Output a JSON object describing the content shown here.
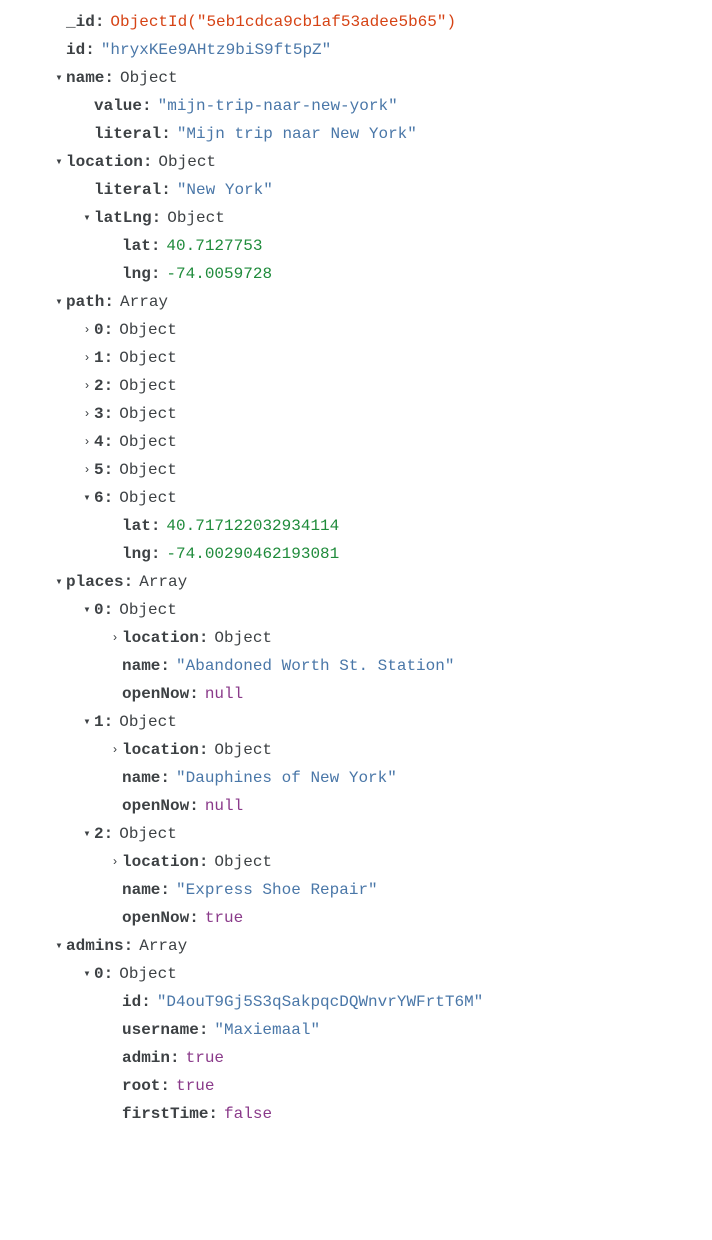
{
  "indentUnit": 28,
  "baseIndent": 52,
  "chevrons": {
    "down": "▾",
    "right": "›"
  },
  "rows": [
    {
      "level": 0,
      "chevron": "none",
      "key": "_id",
      "valueType": "objectid",
      "value": "ObjectId(\"5eb1cdca9cb1af53adee5b65\")"
    },
    {
      "level": 0,
      "chevron": "none",
      "key": "id",
      "valueType": "string",
      "value": "\"hryxKEe9AHtz9biS9ft5pZ\""
    },
    {
      "level": 0,
      "chevron": "down",
      "key": "name",
      "valueType": "type",
      "value": "Object"
    },
    {
      "level": 1,
      "chevron": "none",
      "key": "value",
      "valueType": "string",
      "value": "\"mijn-trip-naar-new-york\""
    },
    {
      "level": 1,
      "chevron": "none",
      "key": "literal",
      "valueType": "string",
      "value": "\"Mijn trip naar New York\""
    },
    {
      "level": 0,
      "chevron": "down",
      "key": "location",
      "valueType": "type",
      "value": "Object"
    },
    {
      "level": 1,
      "chevron": "none",
      "key": "literal",
      "valueType": "string",
      "value": "\"New York\""
    },
    {
      "level": 1,
      "chevron": "down",
      "key": "latLng",
      "valueType": "type",
      "value": "Object"
    },
    {
      "level": 2,
      "chevron": "none",
      "key": "lat",
      "valueType": "number",
      "value": "40.7127753"
    },
    {
      "level": 2,
      "chevron": "none",
      "key": "lng",
      "valueType": "number",
      "value": "-74.0059728"
    },
    {
      "level": 0,
      "chevron": "down",
      "key": "path",
      "valueType": "type",
      "value": "Array"
    },
    {
      "level": 1,
      "chevron": "right",
      "key": "0",
      "valueType": "type",
      "value": "Object"
    },
    {
      "level": 1,
      "chevron": "right",
      "key": "1",
      "valueType": "type",
      "value": "Object"
    },
    {
      "level": 1,
      "chevron": "right",
      "key": "2",
      "valueType": "type",
      "value": "Object"
    },
    {
      "level": 1,
      "chevron": "right",
      "key": "3",
      "valueType": "type",
      "value": "Object"
    },
    {
      "level": 1,
      "chevron": "right",
      "key": "4",
      "valueType": "type",
      "value": "Object"
    },
    {
      "level": 1,
      "chevron": "right",
      "key": "5",
      "valueType": "type",
      "value": "Object"
    },
    {
      "level": 1,
      "chevron": "down",
      "key": "6",
      "valueType": "type",
      "value": "Object"
    },
    {
      "level": 2,
      "chevron": "none",
      "key": "lat",
      "valueType": "number",
      "value": "40.717122032934114"
    },
    {
      "level": 2,
      "chevron": "none",
      "key": "lng",
      "valueType": "number",
      "value": "-74.00290462193081"
    },
    {
      "level": 0,
      "chevron": "down",
      "key": "places",
      "valueType": "type",
      "value": "Array"
    },
    {
      "level": 1,
      "chevron": "down",
      "key": "0",
      "valueType": "type",
      "value": "Object"
    },
    {
      "level": 2,
      "chevron": "right",
      "key": "location",
      "valueType": "type",
      "value": "Object"
    },
    {
      "level": 2,
      "chevron": "none",
      "key": "name",
      "valueType": "string",
      "value": "\"Abandoned Worth St. Station\""
    },
    {
      "level": 2,
      "chevron": "none",
      "key": "openNow",
      "valueType": "bool",
      "value": "null"
    },
    {
      "level": 1,
      "chevron": "down",
      "key": "1",
      "valueType": "type",
      "value": "Object"
    },
    {
      "level": 2,
      "chevron": "right",
      "key": "location",
      "valueType": "type",
      "value": "Object"
    },
    {
      "level": 2,
      "chevron": "none",
      "key": "name",
      "valueType": "string",
      "value": "\"Dauphines of New York\""
    },
    {
      "level": 2,
      "chevron": "none",
      "key": "openNow",
      "valueType": "bool",
      "value": "null"
    },
    {
      "level": 1,
      "chevron": "down",
      "key": "2",
      "valueType": "type",
      "value": "Object"
    },
    {
      "level": 2,
      "chevron": "right",
      "key": "location",
      "valueType": "type",
      "value": "Object"
    },
    {
      "level": 2,
      "chevron": "none",
      "key": "name",
      "valueType": "string",
      "value": "\"Express Shoe Repair\""
    },
    {
      "level": 2,
      "chevron": "none",
      "key": "openNow",
      "valueType": "bool",
      "value": "true"
    },
    {
      "level": 0,
      "chevron": "down",
      "key": "admins",
      "valueType": "type",
      "value": "Array"
    },
    {
      "level": 1,
      "chevron": "down",
      "key": "0",
      "valueType": "type",
      "value": "Object"
    },
    {
      "level": 2,
      "chevron": "none",
      "key": "id",
      "valueType": "string",
      "value": "\"D4ouT9Gj5S3qSakpqcDQWnvrYWFrtT6M\""
    },
    {
      "level": 2,
      "chevron": "none",
      "key": "username",
      "valueType": "string",
      "value": "\"Maxiemaal\""
    },
    {
      "level": 2,
      "chevron": "none",
      "key": "admin",
      "valueType": "bool",
      "value": "true"
    },
    {
      "level": 2,
      "chevron": "none",
      "key": "root",
      "valueType": "bool",
      "value": "true"
    },
    {
      "level": 2,
      "chevron": "none",
      "key": "firstTime",
      "valueType": "bool",
      "value": "false"
    }
  ]
}
